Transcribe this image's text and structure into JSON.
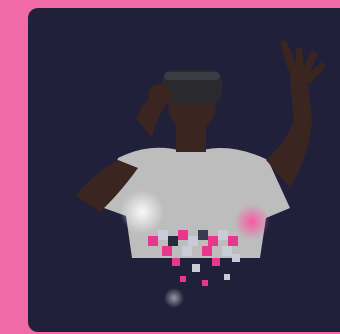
{
  "image": {
    "subject": "vr-user",
    "colors": {
      "page_background": "#f06aa8",
      "card_background": "#20203a",
      "shirt": "#bdbdbd",
      "skin": "#3a2520",
      "headset": "#2a2a2e",
      "accent_pink": "#e8368c",
      "accent_light": "#c9cbd6"
    }
  }
}
